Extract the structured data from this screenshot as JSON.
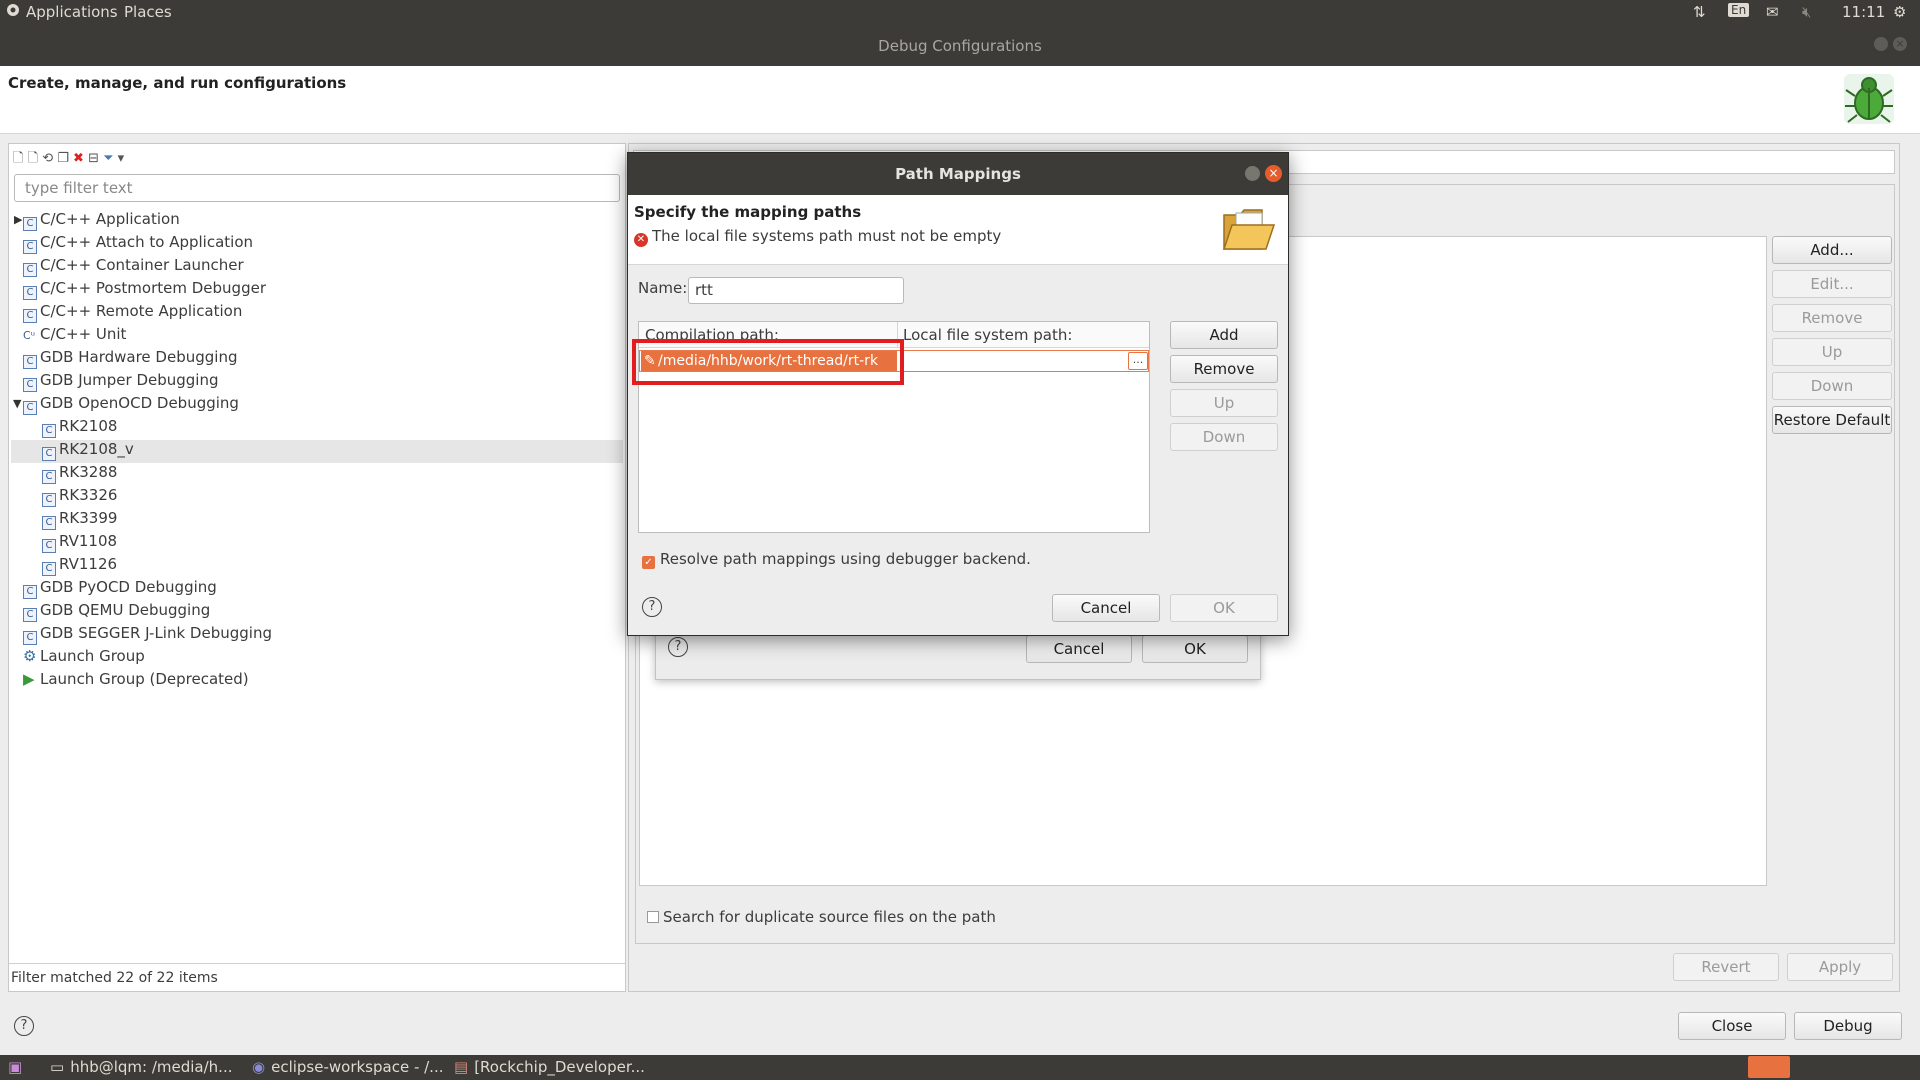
{
  "system_bar": {
    "applications": "Applications",
    "places": "Places",
    "lang": "En",
    "time": "11:11"
  },
  "window": {
    "title": "Debug Configurations"
  },
  "header": {
    "title": "Create, manage, and run configurations"
  },
  "left_panel": {
    "filter_placeholder": "type filter text",
    "items": [
      {
        "label": "C/C++ Application"
      },
      {
        "label": "C/C++ Attach to Application"
      },
      {
        "label": "C/C++ Container Launcher"
      },
      {
        "label": "C/C++ Postmortem Debugger"
      },
      {
        "label": "C/C++ Remote Application"
      },
      {
        "label": "C/C++ Unit"
      },
      {
        "label": "GDB Hardware Debugging"
      },
      {
        "label": "GDB Jumper Debugging"
      },
      {
        "label": "GDB OpenOCD Debugging"
      },
      {
        "label": "RK2108"
      },
      {
        "label": "RK2108_v"
      },
      {
        "label": "RK3288"
      },
      {
        "label": "RK3326"
      },
      {
        "label": "RK3399"
      },
      {
        "label": "RV1108"
      },
      {
        "label": "RV1126"
      },
      {
        "label": "GDB PyOCD Debugging"
      },
      {
        "label": "GDB QEMU Debugging"
      },
      {
        "label": "GDB SEGGER J-Link Debugging"
      },
      {
        "label": "Launch Group"
      },
      {
        "label": "Launch Group (Deprecated)"
      }
    ],
    "status": "Filter matched 22 of 22 items"
  },
  "right_panel": {
    "buttons": {
      "add": "Add...",
      "edit": "Edit...",
      "remove": "Remove",
      "up": "Up",
      "down": "Down",
      "restore_default": "Restore Default"
    },
    "search_duplicates": "Search for duplicate source files on the path",
    "revert": "Revert",
    "apply": "Apply"
  },
  "underlying_dialog": {
    "cancel": "Cancel",
    "ok": "OK"
  },
  "path_mappings_dialog": {
    "title": "Path Mappings",
    "heading": "Specify the mapping paths",
    "error": "The local file systems path must not be empty",
    "name_label": "Name:",
    "name_value": "rtt",
    "col_compilation": "Compilation path:",
    "col_local": "Local file system path:",
    "row_compilation": "/media/hhb/work/rt-thread/rt-rk",
    "browse": "...",
    "add": "Add",
    "remove": "Remove",
    "up": "Up",
    "down": "Down",
    "resolve_label": "Resolve path mappings using debugger backend.",
    "cancel": "Cancel",
    "ok": "OK"
  },
  "bottom": {
    "close": "Close",
    "debug": "Debug"
  },
  "taskbar": {
    "items": [
      "hhb@lqm: /media/h...",
      "eclipse-workspace - /...",
      "[Rockchip_Developer..."
    ]
  }
}
